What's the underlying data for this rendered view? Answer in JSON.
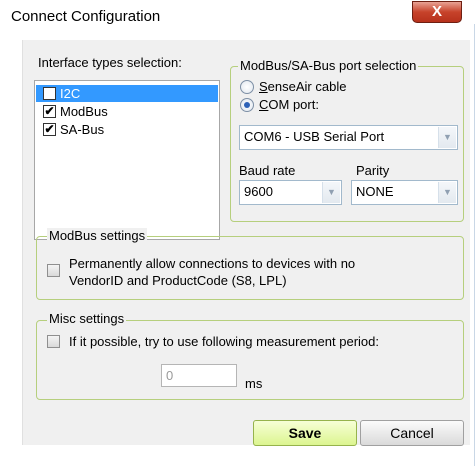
{
  "window": {
    "title": "Connect Configuration",
    "close_glyph": "X"
  },
  "interface_types": {
    "legend": "Interface types selection:",
    "items": [
      {
        "label": "I2C",
        "checked": true,
        "selected": true
      },
      {
        "label": "ModBus",
        "checked": true,
        "selected": false
      },
      {
        "label": "SA-Bus",
        "checked": true,
        "selected": false
      }
    ]
  },
  "port_selection": {
    "legend": "ModBus/SA-Bus port selection",
    "radio_senseair": {
      "label_first": "S",
      "label_rest": "enseAir cable",
      "checked": false
    },
    "radio_com": {
      "label_first": "C",
      "label_rest": "OM port:",
      "checked": true
    },
    "com_port_value": "COM6 - USB Serial Port",
    "baud_label": "Baud rate",
    "baud_value": "9600",
    "parity_label": "Parity",
    "parity_value": "NONE"
  },
  "modbus_settings": {
    "legend": "ModBus settings",
    "allow_label_line1": "Permanently allow connections to devices with no",
    "allow_label_line2": "VendorID and ProductCode (S8, LPL)",
    "allow_checked": false
  },
  "misc_settings": {
    "legend": "Misc settings",
    "period_label": "If it possible, try to use following measurement period:",
    "period_checked": false,
    "period_value": "0",
    "period_unit": "ms"
  },
  "buttons": {
    "save": "Save",
    "cancel": "Cancel"
  }
}
